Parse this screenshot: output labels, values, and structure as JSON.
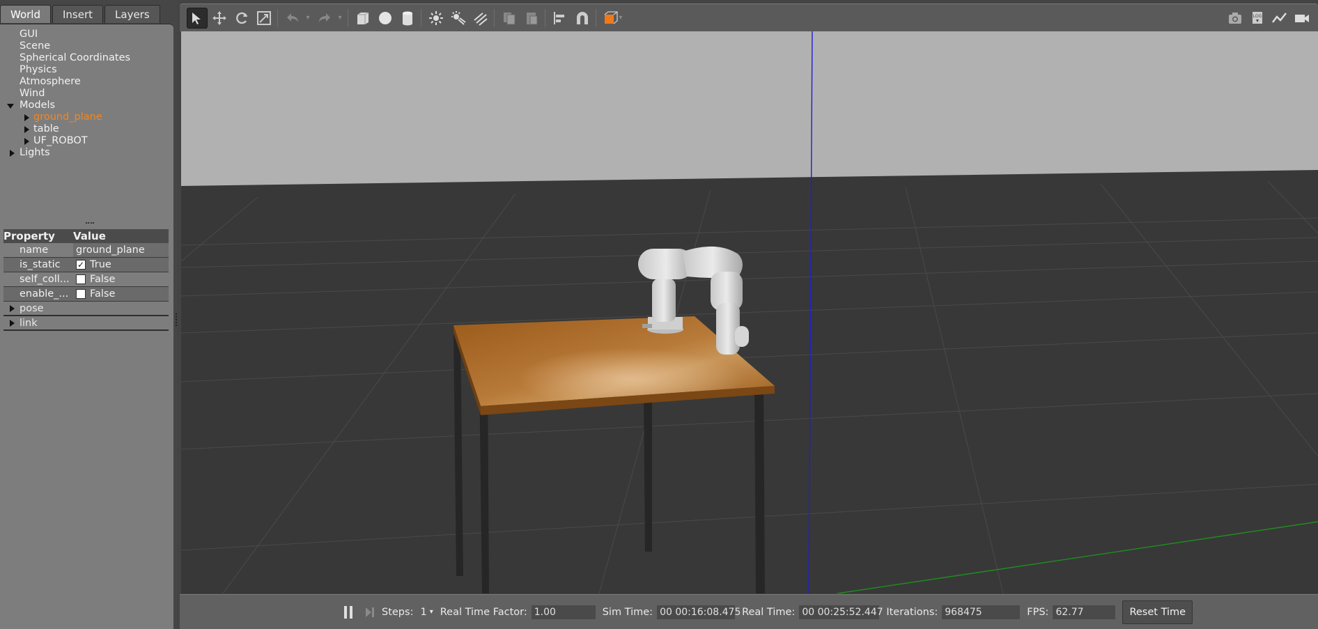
{
  "tabs": [
    {
      "label": "World",
      "active": true
    },
    {
      "label": "Insert",
      "active": false
    },
    {
      "label": "Layers",
      "active": false
    }
  ],
  "tree": {
    "gui": "GUI",
    "scene": "Scene",
    "spherical": "Spherical Coordinates",
    "physics": "Physics",
    "atmosphere": "Atmosphere",
    "wind": "Wind",
    "models": "Models",
    "ground_plane": "ground_plane",
    "table": "table",
    "uf_robot": "UF_ROBOT",
    "lights": "Lights"
  },
  "properties": {
    "header_property": "Property",
    "header_value": "Value",
    "rows": [
      {
        "name": "name",
        "value": "ground_plane"
      },
      {
        "name": "is_static",
        "value": "True",
        "checked": true
      },
      {
        "name": "self_coll...",
        "value": "False",
        "checked": false
      },
      {
        "name": "enable_...",
        "value": "False",
        "checked": false
      }
    ],
    "groups": [
      "pose",
      "link"
    ]
  },
  "toolbar": {
    "icons_left": [
      "select-arrow-icon",
      "translate-icon",
      "rotate-icon",
      "scale-icon",
      "undo-icon",
      "redo-icon",
      "box-icon",
      "sphere-icon",
      "cylinder-icon",
      "point-light-icon",
      "spot-light-icon",
      "directional-light-icon",
      "copy-icon",
      "paste-icon",
      "align-icon",
      "snap-magnet-icon",
      "view-angle-icon"
    ],
    "icons_right": [
      "screenshot-camera-icon",
      "log-icon",
      "plot-icon",
      "video-record-icon"
    ]
  },
  "bottom": {
    "steps_label": "Steps:",
    "steps_value": "1",
    "rtf_label": "Real Time Factor:",
    "rtf_value": "1.00",
    "sim_label": "Sim Time:",
    "sim_value": "00 00:16:08.475",
    "real_label": "Real Time:",
    "real_value": "00 00:25:52.447",
    "iter_label": "Iterations:",
    "iter_value": "968475",
    "fps_label": "FPS:",
    "fps_value": "62.77",
    "reset_label": "Reset Time"
  },
  "colors": {
    "selected_item": "#f4861f",
    "sky": "#b1b1b1",
    "ground": "#383838",
    "z_axis": "#1f1fd0",
    "y_axis": "#1f8f1f",
    "table_top": "#a8661f"
  }
}
